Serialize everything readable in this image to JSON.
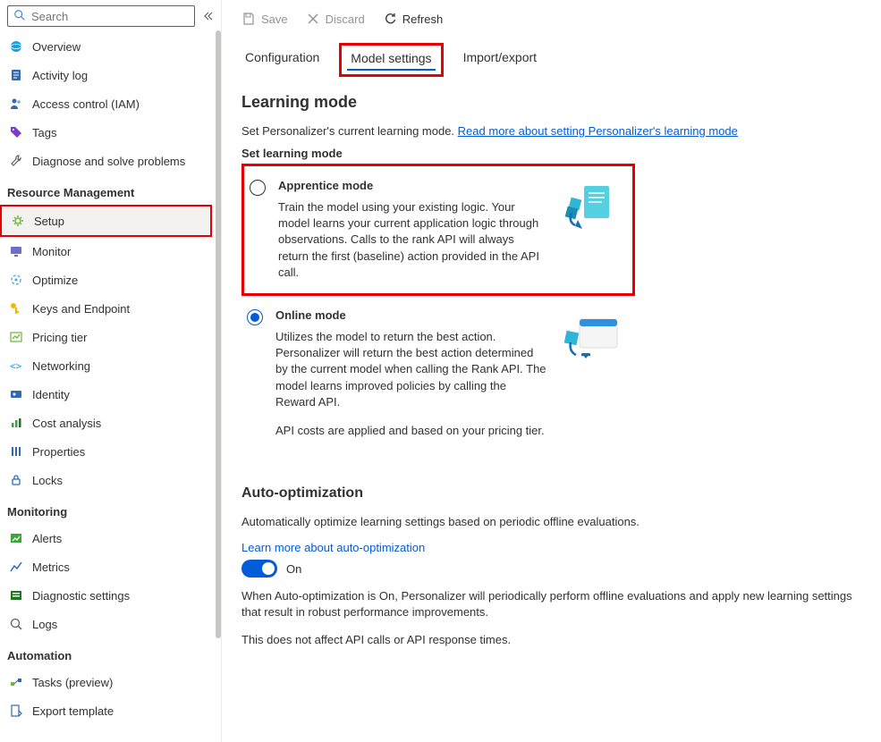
{
  "search": {
    "placeholder": "Search"
  },
  "sidebar": {
    "top": [
      {
        "label": "Overview"
      },
      {
        "label": "Activity log"
      },
      {
        "label": "Access control (IAM)"
      },
      {
        "label": "Tags"
      },
      {
        "label": "Diagnose and solve problems"
      }
    ],
    "sections": [
      {
        "title": "Resource Management",
        "items": [
          {
            "label": "Setup",
            "selected": true
          },
          {
            "label": "Monitor"
          },
          {
            "label": "Optimize"
          },
          {
            "label": "Keys and Endpoint"
          },
          {
            "label": "Pricing tier"
          },
          {
            "label": "Networking"
          },
          {
            "label": "Identity"
          },
          {
            "label": "Cost analysis"
          },
          {
            "label": "Properties"
          },
          {
            "label": "Locks"
          }
        ]
      },
      {
        "title": "Monitoring",
        "items": [
          {
            "label": "Alerts"
          },
          {
            "label": "Metrics"
          },
          {
            "label": "Diagnostic settings"
          },
          {
            "label": "Logs"
          }
        ]
      },
      {
        "title": "Automation",
        "items": [
          {
            "label": "Tasks (preview)"
          },
          {
            "label": "Export template"
          }
        ]
      }
    ]
  },
  "toolbar": {
    "save": "Save",
    "discard": "Discard",
    "refresh": "Refresh"
  },
  "tabs": [
    {
      "label": "Configuration"
    },
    {
      "label": "Model settings",
      "active": true
    },
    {
      "label": "Import/export"
    }
  ],
  "learning": {
    "title": "Learning mode",
    "desc": "Set Personalizer's current learning mode.",
    "link": "Read more about setting Personalizer's learning mode",
    "setLabel": "Set learning mode",
    "modes": [
      {
        "title": "Apprentice mode",
        "desc": "Train the model using your existing logic. Your model learns your current application logic through observations. Calls to the rank API will always return the first (baseline) action provided in the API call.",
        "checked": false
      },
      {
        "title": "Online mode",
        "desc": "Utilizes the model to return the best action. Personalizer will return the best action determined by the current model when calling the Rank API. The model learns improved policies by calling the Reward API.",
        "desc2": "API costs are applied and based on your pricing tier.",
        "checked": true
      }
    ]
  },
  "autoopt": {
    "title": "Auto-optimization",
    "para1": "Automatically optimize learning settings based on periodic offline evaluations.",
    "link": "Learn more about auto-optimization",
    "toggleLabel": "On",
    "toggleOn": true,
    "para2": "When Auto-optimization is On, Personalizer will periodically perform offline evaluations and apply new learning settings that result in robust performance improvements.",
    "para3": "This does not affect API calls or API response times."
  }
}
